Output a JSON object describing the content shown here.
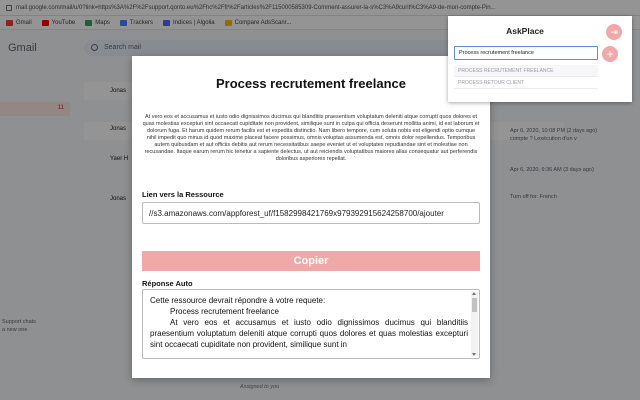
{
  "browser": {
    "url": "mail.google.com/mail/u/0?link=https%3A%2F%2Fsupport.qonto.eu%2Fhc%2Ffr%2Farticles%2F115000585309-Comment-assurer-la-s%C3%A9curit%C3%A9-de-mon-compte-Pin...",
    "bookmarks": [
      "Gmail",
      "YouTube",
      "Maps",
      "Trackers",
      "Indices | Algolia",
      "Compare AdsScanr..."
    ]
  },
  "gmail": {
    "logo": "Gmail",
    "search_placeholder": "Search mail",
    "inbox_count": "11",
    "senders": [
      "Jonas",
      "Jonas",
      "Yaer H",
      "Jonas"
    ],
    "dates": [
      "Apr 6, 2020, 10:08 PM (2 days ago)",
      "Apr 6, 2020, 9:36 AM (3 days ago)"
    ],
    "thread_preview": "compte ? Lexécution d'un v",
    "translate": "Turn off for: French",
    "assigned": "Assigned to you",
    "side_texts": [
      "Support chats",
      "a new one"
    ]
  },
  "modal": {
    "title": "Process recrutement freelance",
    "description": "At vero eos et accusamus et iusto odio dignissimos ducimus qui blanditiis praesentium voluptatum deleniti atque corrupti quos dolores et quas molestias excepturi sint occaecati cupiditate non provident, similique sunt in culpa qui officia deserunt mollitia animi, id est laborum et dolorum fuga. Et harum quidem rerum facilis est et expedita distinctio. Nam libero tempore, cum soluta nobis est eligendi optio cumque nihil impedit quo minus id quod maxime placeat facere possimus, omnis voluptas assumenda est, omnis dolor repellendus. Temporibus autem quibusdam et aut officiis debitis aut rerum necessitatibus saepe eveniet ut et voluptates repudiandae sint et molestiae non recusandae. Itaque earum rerum hic tenetur a sapiente delectus, ut aut reiciendis voluptatibus maiores alias consequatur aut perferendis doloribus asperiores repellat.",
    "link_label": "Lien vers la Ressource",
    "link_value": "//s3.amazonaws.com/appforest_uf/f1582998421769x979392915624258700/ajouter",
    "copy_label": "Copier",
    "auto_label": "Réponse Auto",
    "auto_line1": "Cette ressource devrait répondre à votre requete:",
    "auto_line2": "Process recrutement freelance",
    "auto_line3": "At vero eos et accusamus et iusto odio dignissimos ducimus qui blanditiis praesentium voluptatum deleniti atque corrupti quos dolores et quas molestias excepturi sint occaecati cupiditate non provident, similique sunt in"
  },
  "popup": {
    "title": "AskPlace",
    "search_value": "Process recrutement freelance",
    "suggestions": [
      "PROCESS RECRUTEMENT FREELANCE",
      "PROCESS RETOUR CLIENT"
    ],
    "add_symbol": "+",
    "exit_symbol": "⇥"
  },
  "colors": {
    "accent": "#f1a8a8",
    "input_border": "#5b8fd6"
  }
}
